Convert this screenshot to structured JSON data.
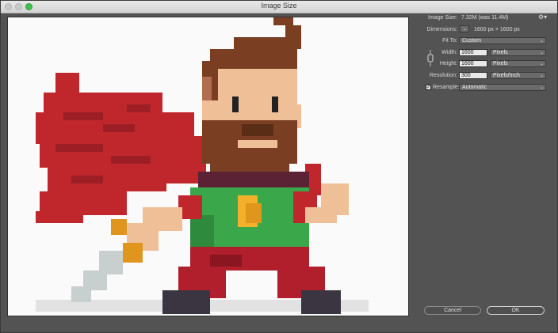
{
  "window": {
    "title": "Image Size"
  },
  "image_size": {
    "label": "Image Size:",
    "value": "7.32M (was 11.4M)"
  },
  "dimensions": {
    "label": "Dimensions:",
    "value": "1600 px  ×  1600 px"
  },
  "fit_to": {
    "label": "Fit To:",
    "value": "Custom"
  },
  "width": {
    "label": "Width:",
    "value": "1600",
    "unit": "Pixels"
  },
  "height": {
    "label": "Height:",
    "value": "1600",
    "unit": "Pixels"
  },
  "resolution": {
    "label": "Resolution:",
    "value": "300",
    "unit": "Pixels/Inch"
  },
  "resample": {
    "label": "Resample:",
    "value": "Automatic",
    "checked": true
  },
  "buttons": {
    "cancel": "Cancel",
    "ok": "OK"
  },
  "icons": {
    "gear": "gear-icon",
    "chevron": "chevron-down-icon",
    "link": "chain-link-icon",
    "check": "checkmark-icon"
  }
}
